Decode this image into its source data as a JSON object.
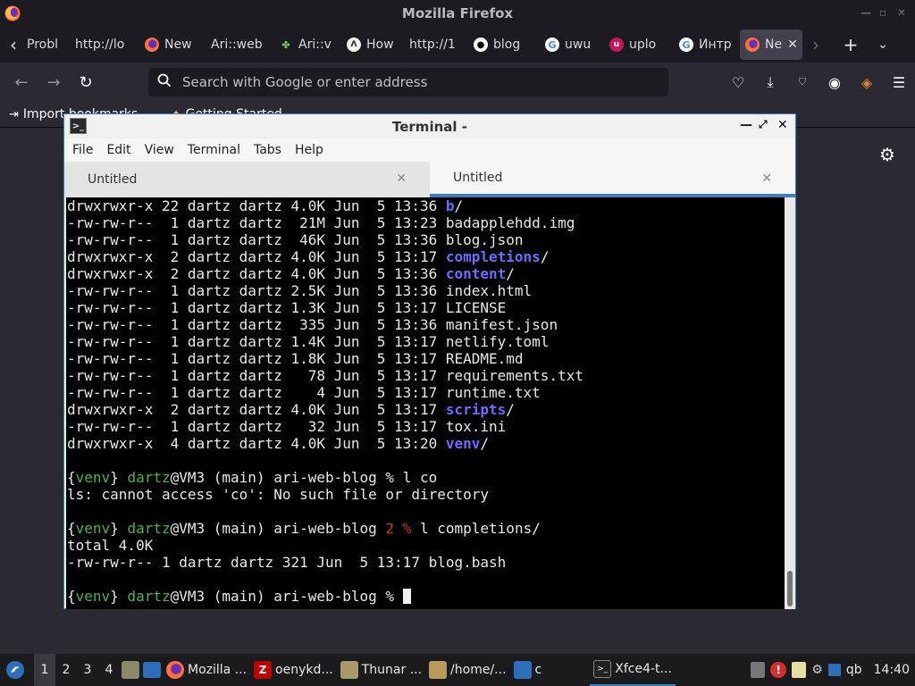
{
  "firefox": {
    "window_title": "Mozilla Firefox",
    "tabs": [
      {
        "label": "Probl",
        "icon": "page-icon"
      },
      {
        "label": "http://lo",
        "icon": "none"
      },
      {
        "label": "New",
        "icon": "firefox-icon"
      },
      {
        "label": "Ari::web",
        "icon": "none"
      },
      {
        "label": "Ari::v",
        "icon": "puzzle-icon"
      },
      {
        "label": "How",
        "icon": "shield-icon"
      },
      {
        "label": "http://1",
        "icon": "none"
      },
      {
        "label": "blog",
        "icon": "github-icon"
      },
      {
        "label": "uwu",
        "icon": "google-icon"
      },
      {
        "label": "uplo",
        "icon": "upload-icon"
      },
      {
        "label": "Интр",
        "icon": "google-icon"
      },
      {
        "label": "Ne",
        "icon": "firefox-icon",
        "active": true
      }
    ],
    "urlbar_placeholder": "Search with Google or enter address",
    "bookmarks": [
      {
        "label": "Import bookmarks...",
        "icon": "import-icon"
      },
      {
        "label": "Getting Started",
        "icon": "star-icon"
      }
    ]
  },
  "terminal": {
    "title": "Terminal -",
    "menu": [
      "File",
      "Edit",
      "View",
      "Terminal",
      "Tabs",
      "Help"
    ],
    "tabs": [
      {
        "label": "Untitled",
        "active": false
      },
      {
        "label": "Untitled",
        "active": true
      }
    ],
    "lines": [
      [
        {
          "t": "drwxrwxr-x 22 dartz dartz 4.0K Jun  5 13:36 "
        },
        {
          "t": "b",
          "c": "dir"
        },
        {
          "t": "/"
        }
      ],
      [
        {
          "t": "-rw-rw-r--  1 dartz dartz  21M Jun  5 13:23 badapplehdd.img"
        }
      ],
      [
        {
          "t": "-rw-rw-r--  1 dartz dartz  46K Jun  5 13:36 blog.json"
        }
      ],
      [
        {
          "t": "drwxrwxr-x  2 dartz dartz 4.0K Jun  5 13:17 "
        },
        {
          "t": "completions",
          "c": "dir"
        },
        {
          "t": "/"
        }
      ],
      [
        {
          "t": "drwxrwxr-x  2 dartz dartz 4.0K Jun  5 13:36 "
        },
        {
          "t": "content",
          "c": "dir"
        },
        {
          "t": "/"
        }
      ],
      [
        {
          "t": "-rw-rw-r--  1 dartz dartz 2.5K Jun  5 13:36 index.html"
        }
      ],
      [
        {
          "t": "-rw-rw-r--  1 dartz dartz 1.3K Jun  5 13:17 LICENSE"
        }
      ],
      [
        {
          "t": "-rw-rw-r--  1 dartz dartz  335 Jun  5 13:36 manifest.json"
        }
      ],
      [
        {
          "t": "-rw-rw-r--  1 dartz dartz 1.4K Jun  5 13:17 netlify.toml"
        }
      ],
      [
        {
          "t": "-rw-rw-r--  1 dartz dartz 1.8K Jun  5 13:17 README.md"
        }
      ],
      [
        {
          "t": "-rw-rw-r--  1 dartz dartz   78 Jun  5 13:17 requirements.txt"
        }
      ],
      [
        {
          "t": "-rw-rw-r--  1 dartz dartz    4 Jun  5 13:17 runtime.txt"
        }
      ],
      [
        {
          "t": "drwxrwxr-x  2 dartz dartz 4.0K Jun  5 13:17 "
        },
        {
          "t": "scripts",
          "c": "dir"
        },
        {
          "t": "/"
        }
      ],
      [
        {
          "t": "-rw-rw-r--  1 dartz dartz   32 Jun  5 13:17 tox.ini"
        }
      ],
      [
        {
          "t": "drwxrwxr-x  4 dartz dartz 4.0K Jun  5 13:20 "
        },
        {
          "t": "venv",
          "c": "dir"
        },
        {
          "t": "/"
        }
      ],
      [
        {
          "t": ""
        }
      ],
      [
        {
          "t": "{"
        },
        {
          "t": "venv",
          "c": "grn"
        },
        {
          "t": "} "
        },
        {
          "t": "dartz",
          "c": "grn"
        },
        {
          "t": "@VM3 (main) ari-web-blog % l co"
        }
      ],
      [
        {
          "t": "ls: cannot access 'co': No such file or directory"
        }
      ],
      [
        {
          "t": ""
        }
      ],
      [
        {
          "t": "{"
        },
        {
          "t": "venv",
          "c": "grn"
        },
        {
          "t": "} "
        },
        {
          "t": "dartz",
          "c": "grn"
        },
        {
          "t": "@VM3 (main) ari-web-blog "
        },
        {
          "t": "2 %",
          "c": "red"
        },
        {
          "t": " l completions/"
        }
      ],
      [
        {
          "t": "total 4.0K"
        }
      ],
      [
        {
          "t": "-rw-rw-r-- 1 dartz dartz 321 Jun  5 13:17 blog.bash"
        }
      ],
      [
        {
          "t": ""
        }
      ],
      [
        {
          "t": "{"
        },
        {
          "t": "venv",
          "c": "grn"
        },
        {
          "t": "} "
        },
        {
          "t": "dartz",
          "c": "grn"
        },
        {
          "t": "@VM3 (main) ari-web-blog % "
        },
        {
          "t": "",
          "c": "cursor"
        }
      ]
    ]
  },
  "taskbar": {
    "workspaces": [
      "1",
      "2",
      "3",
      "4"
    ],
    "active_workspace": "1",
    "windows": [
      {
        "label": "Mozilla ...",
        "icon": "firefox-icon"
      },
      {
        "label": "oenykd...",
        "icon": "filezilla-icon"
      },
      {
        "label": "Thunar ...",
        "icon": "folder-icon"
      },
      {
        "label": "/home/...",
        "icon": "archive-icon"
      },
      {
        "label": "c",
        "icon": "window-icon"
      },
      {
        "label": "Xfce4-t...",
        "icon": "terminal-icon",
        "active": true
      }
    ],
    "tray_qb": "qb",
    "clock": "14:40"
  },
  "colors": {
    "accent": "#3c7fc1",
    "terminal_dir": "#6b6bff",
    "terminal_green": "#4eb34e",
    "terminal_red": "#cd2d2d"
  }
}
